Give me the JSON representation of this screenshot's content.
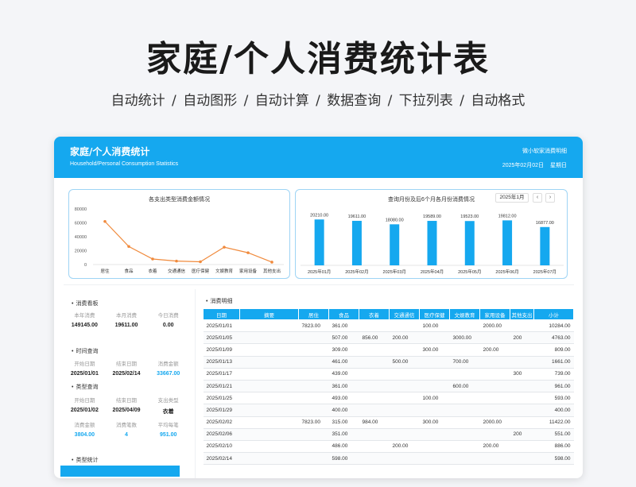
{
  "hero": {
    "title": "家庭/个人消费统计表",
    "subtitle": "自动统计  /  自动图形  /  自动计算  /  数据查询  /  下拉列表  /  自动格式"
  },
  "banner": {
    "title": "家庭/个人消费统计",
    "subtitle": "Household/Personal Consumption Statistics",
    "right_top": "微小软家消费明细",
    "date": "2025年02月02日",
    "weekday": "星期日"
  },
  "chart_data": [
    {
      "type": "line",
      "title": "各支出类型消费金额情况",
      "categories": [
        "居住",
        "食品",
        "衣着",
        "交通通信",
        "医疗保健",
        "文娱教育",
        "家用设备",
        "其他支出"
      ],
      "values": [
        62000,
        26000,
        8000,
        5000,
        4000,
        25000,
        17000,
        3500
      ],
      "ylim": [
        0,
        80000
      ],
      "yticks": [
        "80000",
        "60000",
        "40000",
        "20000",
        "0"
      ],
      "color": "#f08a3c"
    },
    {
      "type": "bar",
      "title": "查询月份及后6个月各月份消费情况",
      "month_select": "2025年1月",
      "categories": [
        "2025年01月",
        "2025年02月",
        "2025年03月",
        "2025年04月",
        "2025年05月",
        "2025年06月",
        "2025年07月"
      ],
      "values": [
        20210.0,
        19611.0,
        18080.0,
        19589.0,
        19523.0,
        19812.0,
        16877.0
      ],
      "labels": [
        "20210.00",
        "19611.00",
        "18080.00",
        "19589.00",
        "19523.00",
        "19812.00",
        "16877.00"
      ],
      "color": "#15a8ef"
    }
  ],
  "dashboard": {
    "title": "消费看板",
    "labels": [
      "本年消费",
      "本月消费",
      "今日消费"
    ],
    "values": [
      "149145.00",
      "19611.00",
      "0.00"
    ]
  },
  "time_query": {
    "title": "时间查询",
    "labels": [
      "开始日期",
      "结束日期",
      "消费金额"
    ],
    "values": [
      "2025/01/01",
      "2025/02/14",
      "33667.00"
    ]
  },
  "type_query": {
    "title": "类型查询",
    "labels": [
      "开始日期",
      "结束日期",
      "支出类型"
    ],
    "values": [
      "2025/01/02",
      "2025/04/09",
      "衣着"
    ],
    "labels2": [
      "消费金额",
      "消费笔数",
      "平均每笔"
    ],
    "values2": [
      "3804.00",
      "4",
      "951.00"
    ]
  },
  "type_stats": {
    "title": "类型统计"
  },
  "table": {
    "title": "消费明细",
    "headers": [
      "日期",
      "摘要",
      "居住",
      "食品",
      "衣着",
      "交通通信",
      "医疗保健",
      "文娱教育",
      "家用设备",
      "其他支出",
      "小计"
    ],
    "rows": [
      [
        "2025/01/01",
        "",
        "7823.00",
        "361.00",
        "",
        "",
        "100.00",
        "",
        "2000.00",
        "",
        "10284.00"
      ],
      [
        "2025/01/05",
        "",
        "",
        "507.00",
        "856.00",
        "200.00",
        "",
        "3000.00",
        "",
        "200",
        "4763.00"
      ],
      [
        "2025/01/09",
        "",
        "",
        "309.00",
        "",
        "",
        "300.00",
        "",
        "200.00",
        "",
        "809.00"
      ],
      [
        "2025/01/13",
        "",
        "",
        "461.00",
        "",
        "500.00",
        "",
        "700.00",
        "",
        "",
        "1661.00"
      ],
      [
        "2025/01/17",
        "",
        "",
        "439.00",
        "",
        "",
        "",
        "",
        "",
        "300",
        "739.00"
      ],
      [
        "2025/01/21",
        "",
        "",
        "361.00",
        "",
        "",
        "",
        "600.00",
        "",
        "",
        "961.00"
      ],
      [
        "2025/01/25",
        "",
        "",
        "493.00",
        "",
        "",
        "100.00",
        "",
        "",
        "",
        "593.00"
      ],
      [
        "2025/01/29",
        "",
        "",
        "400.00",
        "",
        "",
        "",
        "",
        "",
        "",
        "400.00"
      ],
      [
        "2025/02/02",
        "",
        "7823.00",
        "315.00",
        "984.00",
        "",
        "300.00",
        "",
        "2000.00",
        "",
        "11422.00"
      ],
      [
        "2025/02/06",
        "",
        "",
        "351.00",
        "",
        "",
        "",
        "",
        "",
        "200",
        "551.00"
      ],
      [
        "2025/02/10",
        "",
        "",
        "486.00",
        "",
        "200.00",
        "",
        "",
        "200.00",
        "",
        "886.00"
      ],
      [
        "2025/02/14",
        "",
        "",
        "598.00",
        "",
        "",
        "",
        "",
        "",
        "",
        "598.00"
      ]
    ]
  }
}
